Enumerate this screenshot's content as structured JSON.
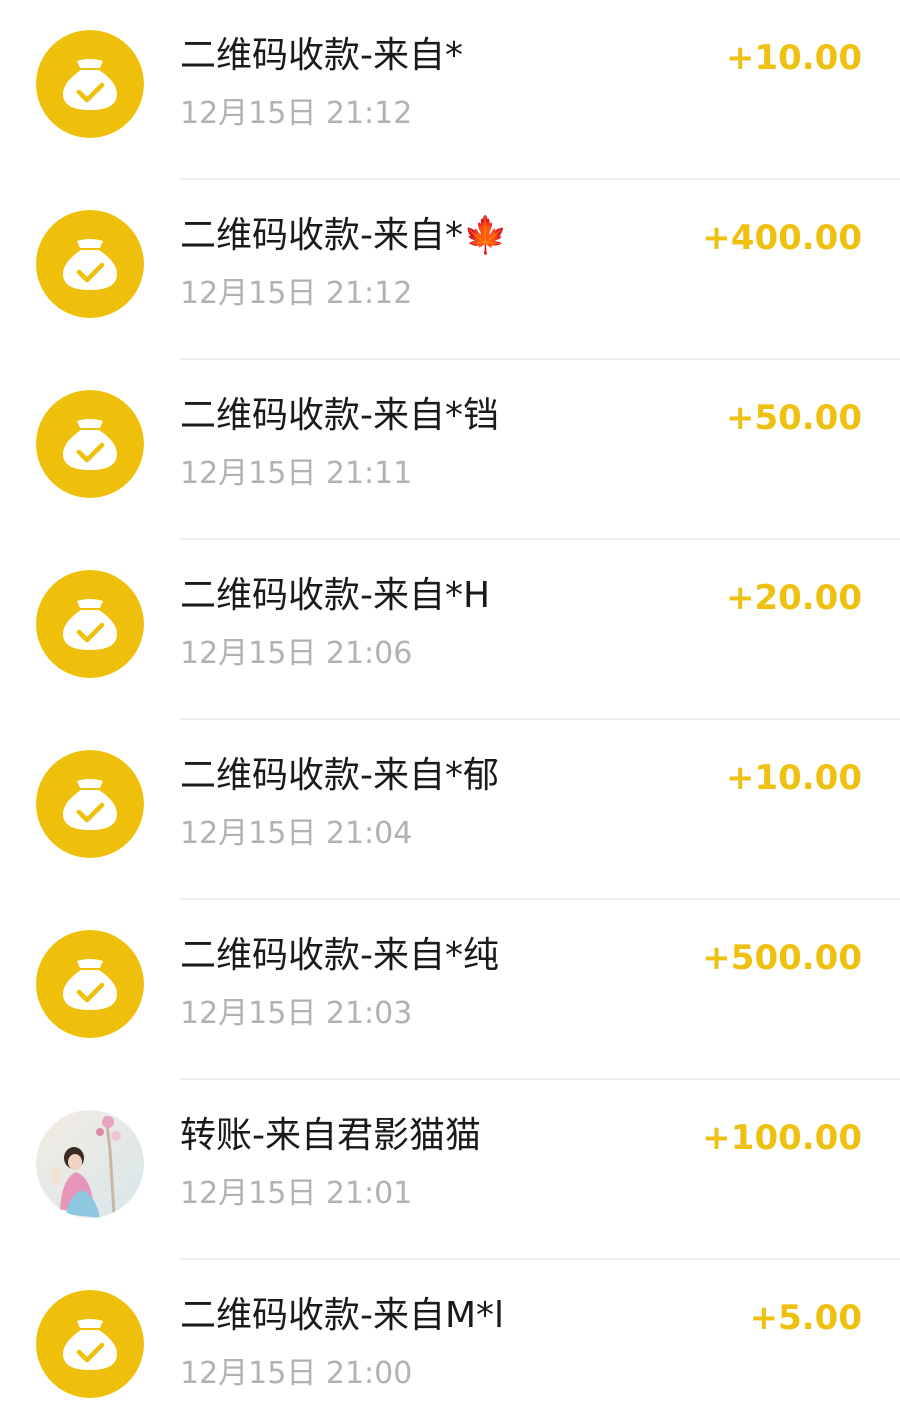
{
  "colors": {
    "amount": "#f0c010",
    "icon_bg": "#eebf0b",
    "title": "#1a1a1a",
    "time": "#b2b2b2",
    "divider": "#ececec"
  },
  "transactions": [
    {
      "icon": "money-bag-check-icon",
      "title": "二维码收款-来自*",
      "time": "12月15日 21:12",
      "amount": "+10.00"
    },
    {
      "icon": "money-bag-check-icon",
      "title": "二维码收款-来自*🍁",
      "time": "12月15日 21:12",
      "amount": "+400.00"
    },
    {
      "icon": "money-bag-check-icon",
      "title": "二维码收款-来自*铛",
      "time": "12月15日 21:11",
      "amount": "+50.00"
    },
    {
      "icon": "money-bag-check-icon",
      "title": "二维码收款-来自*H",
      "time": "12月15日 21:06",
      "amount": "+20.00"
    },
    {
      "icon": "money-bag-check-icon",
      "title": "二维码收款-来自*郁",
      "time": "12月15日 21:04",
      "amount": "+10.00"
    },
    {
      "icon": "money-bag-check-icon",
      "title": "二维码收款-来自*纯",
      "time": "12月15日 21:03",
      "amount": "+500.00"
    },
    {
      "icon": "user-avatar-photo",
      "title": "转账-来自君影猫猫",
      "time": "12月15日 21:01",
      "amount": "+100.00"
    },
    {
      "icon": "money-bag-check-icon",
      "title": "二维码收款-来自M*l",
      "time": "12月15日 21:00",
      "amount": "+5.00"
    }
  ]
}
